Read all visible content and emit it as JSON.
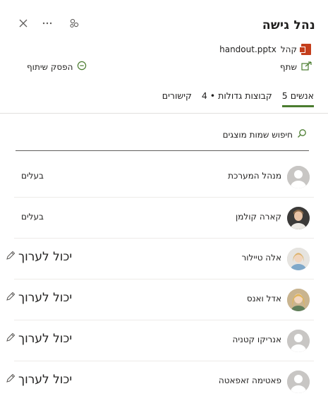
{
  "header": {
    "title": "נהל גישה"
  },
  "file": {
    "name": "handout.pptx",
    "prefix": "קהל"
  },
  "actions": {
    "share_label": "שתף",
    "stop_sharing_label": "הפסק שיתוף"
  },
  "tabs": [
    {
      "label": "אנשים 5"
    },
    {
      "label": "קבוצות גדולות • 4"
    },
    {
      "label": "קישורים"
    }
  ],
  "search": {
    "placeholder": "חיפוש שמות מוצגים"
  },
  "people": [
    {
      "name": "מנהל המערכת",
      "permission": "בעלים",
      "avatar": "default"
    },
    {
      "name": "קארה קולמן",
      "permission": "בעלים",
      "avatar": "photo-dark"
    },
    {
      "name": "אלה טיילור",
      "permission": "יכול לערוך",
      "avatar": "photo-light"
    },
    {
      "name": "אדל ואנס",
      "permission": "יכול לערוך",
      "avatar": "photo-blonde"
    },
    {
      "name": "אנריקו קטניה",
      "permission": "יכול לערוך",
      "avatar": "default"
    },
    {
      "name": "פאטימה זאפאטה",
      "permission": "יכול לערוך",
      "avatar": "default"
    }
  ],
  "colors": {
    "accent": "#4a7c2f",
    "ppt": "#c43e1c"
  }
}
